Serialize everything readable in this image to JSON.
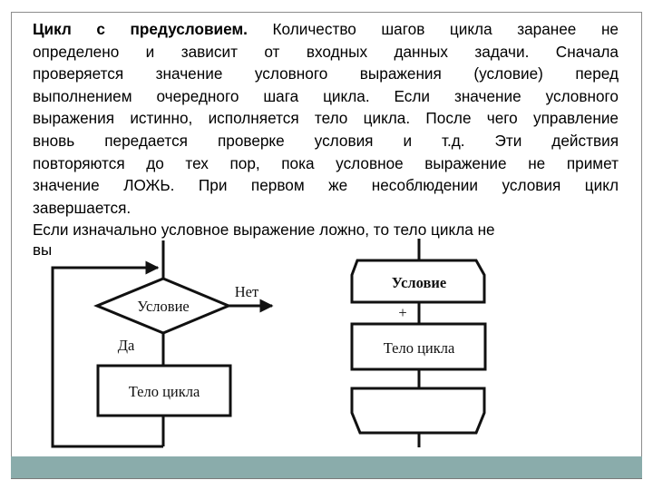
{
  "slide": {
    "heading": "Цикл с предусловием.",
    "paragraph_lines": [
      " Количество шагов цикла заранее не",
      "определено и зависит от входных данных задачи. Сначала",
      "проверяется значение условного выражения (условие) перед",
      "выполнением очередного шага цикла. Если значение условного",
      "выражения истинно, исполняется тело цикла. После чего управление",
      "вновь передается проверке условия и т.д. Эти действия",
      "повторяются до тех пор, пока условное выражение не примет",
      "значение ЛОЖЬ. При первом же несоблюдении условия цикл",
      "завершается."
    ],
    "second_paragraph": "Если изначально условное выражение ложно, то тело цикла не",
    "clipped_line_fragment": "вы"
  },
  "flowchart_left": {
    "condition_label": "Условие",
    "no_label": "Нет",
    "yes_label": "Да",
    "body_label": "Тело цикла"
  },
  "flowchart_right": {
    "condition_label": "Условие",
    "plus_label": "+",
    "body_label": "Тело цикла"
  },
  "colors": {
    "footer_bar": "#8aacab",
    "frame": "#8c8c8c"
  }
}
